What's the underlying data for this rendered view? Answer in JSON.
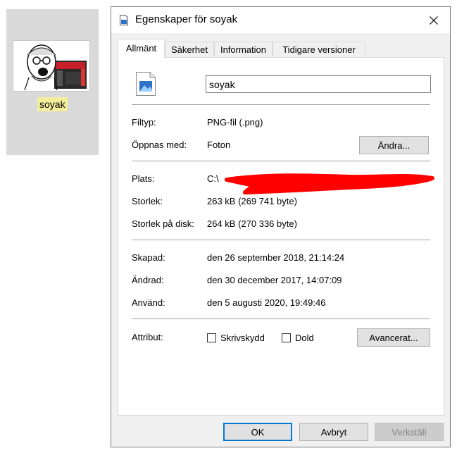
{
  "desktop": {
    "file_name": "soyak"
  },
  "dialog": {
    "title": "Egenskaper för soyak",
    "tabs": [
      {
        "label": "Allmänt"
      },
      {
        "label": "Säkerhet"
      },
      {
        "label": "Information"
      },
      {
        "label": "Tidigare versioner"
      }
    ],
    "name_value": "soyak",
    "filetype_label": "Filtyp:",
    "filetype_value": "PNG-fil (.png)",
    "opens_with_label": "Öppnas med:",
    "opens_with_value": "Foton",
    "change_button": "Ändra...",
    "location_label": "Plats:",
    "location_value": "C:\\",
    "size_label": "Storlek:",
    "size_value": "263 kB (269 741 byte)",
    "size_on_disk_label": "Storlek på disk:",
    "size_on_disk_value": "264 kB (270 336 byte)",
    "created_label": "Skapad:",
    "created_value": "den 26 september 2018, 21:14:24",
    "modified_label": "Ändrad:",
    "modified_value": "den 30 december 2017, 14:07:09",
    "accessed_label": "Använd:",
    "accessed_value": "den 5 augusti 2020, 19:49:46",
    "attributes_label": "Attribut:",
    "readonly_label": "Skrivskydd",
    "readonly_checked": false,
    "hidden_label": "Dold",
    "hidden_checked": false,
    "advanced_button": "Avancerat...",
    "ok_button": "OK",
    "cancel_button": "Avbryt",
    "apply_button": "Verkställ"
  },
  "colors": {
    "accent": "#0078d7",
    "selection_highlight": "#f3ee9c",
    "redaction": "#ff0000"
  }
}
